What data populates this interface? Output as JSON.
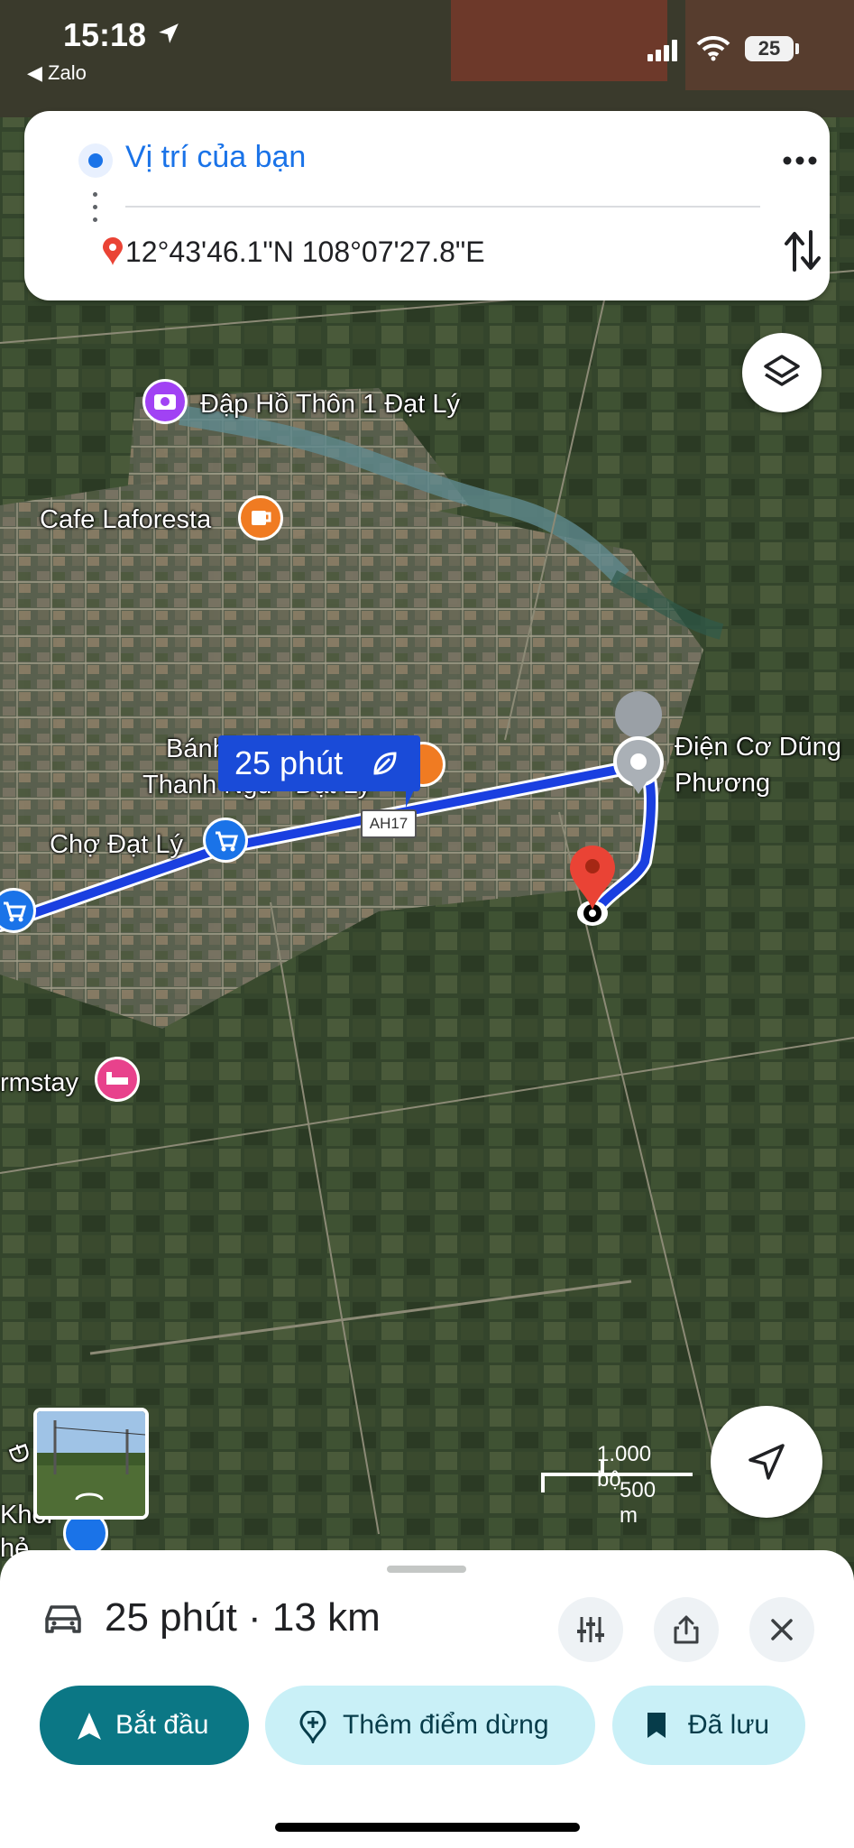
{
  "status_bar": {
    "time": "15:18",
    "back_app": "◀ Zalo",
    "battery": "25"
  },
  "route_card": {
    "origin": "Vị trí của bạn",
    "destination": "12°43'46.1\"N 108°07'27.8\"E",
    "more_icon": "more-horiz-icon",
    "swap_icon": "swap-vertical-icon"
  },
  "map": {
    "eta_chip": "25 phút",
    "road_shield": "AH17",
    "pois": {
      "dap_ho": "Đập Hồ Thôn 1 Đạt Lý",
      "cafe": "Cafe Laforesta",
      "banh_line1": "Bánh",
      "banh_line2": "Thanh Ngu - Đạt Lý",
      "cho": "Chợ Đạt Lý",
      "dien_co_line1": "Điện Cơ Dũng",
      "dien_co_line2": "Phương",
      "farmstay": "rmstay",
      "khoi_line1": "Khoi",
      "khoi_line2": "hẻ",
      "left_edge": "Đ"
    },
    "scale_imperial": "1.000 bộ",
    "scale_metric": "500 m",
    "colors": {
      "route": "#1a3fe0",
      "poi_purple": "#a142f4",
      "poi_orange": "#f07b22",
      "poi_blue": "#1a73e8",
      "poi_pink": "#e8428c",
      "pin_red": "#ea4335"
    }
  },
  "bottom_sheet": {
    "summary": "25 phút · 13 km",
    "start_label": "Bắt đầu",
    "add_stop_label": "Thêm điểm dừng",
    "saved_label": "Đã lưu",
    "accent": "#0b7785"
  }
}
